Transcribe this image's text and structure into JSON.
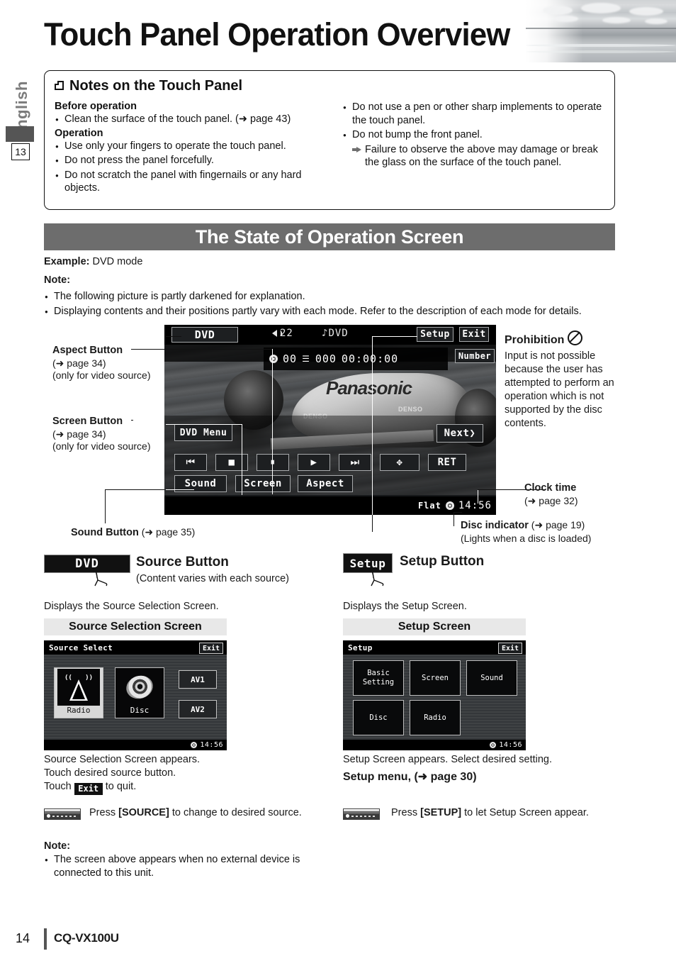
{
  "rail": {
    "language": "English",
    "chapter_number": "13"
  },
  "header": {
    "title": "Touch Panel Operation Overview"
  },
  "notes_box": {
    "heading": "Notes on the Touch Panel",
    "left": {
      "before_operation_head": "Before operation",
      "before_operation_items": [
        "Clean the surface of the touch panel. (➜ page 43)"
      ],
      "operation_head": "Operation",
      "operation_items": [
        "Use only your fingers to operate the touch panel.",
        "Do not press the panel forcefully.",
        "Do not scratch the panel with fingernails or any hard objects."
      ]
    },
    "right": {
      "items": [
        "Do not use a pen or other sharp implements to operate the touch panel.",
        "Do not bump the front panel."
      ],
      "sub_item": "Failure to observe the above may damage or break the glass on the surface of the touch panel."
    }
  },
  "section": {
    "bar_title": "The State of Operation Screen",
    "example_label": "Example:",
    "example_value": "DVD mode",
    "note_head": "Note:",
    "note_items": [
      "The following picture is partly darkened for explanation.",
      "Displaying contents and their positions partly vary with each mode. Refer to the description of each mode for details."
    ]
  },
  "dvd_screen": {
    "source_button": "DVD",
    "volume": "22",
    "source_indicator": "DVD",
    "setup_button": "Setup",
    "exit_button": "Exit",
    "chapter_value": "00",
    "track_value": "000",
    "time_value": "00:00:00",
    "number_button": "Number",
    "dvd_menu_button": "DVD Menu",
    "next_button": "Next❯",
    "controls": [
      "⏮",
      "■",
      "⏸",
      "▶",
      "⏭",
      "✥"
    ],
    "ret_button": "RET",
    "sound_button": "Sound",
    "screen_button": "Screen",
    "aspect_button": "Aspect",
    "eq_status": "Flat",
    "clock": "14:56"
  },
  "callouts": {
    "aspect": {
      "title": "Aspect Button",
      "ref": "(➜ page 34)",
      "note": "(only for video source)"
    },
    "screen": {
      "title": "Screen Button",
      "ref": "(➜ page 34)",
      "note": "(only for video source)"
    },
    "sound": {
      "title": "Sound Button",
      "ref": "(➜ page 35)"
    },
    "prohibition": {
      "title": "Prohibition",
      "body": "Input is not possible because the user has attempted to perform an operation which is not supported by the disc contents."
    },
    "clock_time": {
      "title": "Clock time",
      "ref": "(➜ page 32)"
    },
    "disc_indicator": {
      "title": "Disc indicator",
      "ref": "(➜ page 19)",
      "note": "(Lights when a disc is loaded)"
    }
  },
  "source_column": {
    "icon_label": "DVD",
    "title": "Source Button",
    "subtitle": "(Content varies with each source)",
    "description": "Displays the Source Selection Screen.",
    "screen_label": "Source Selection Screen",
    "device": {
      "top_title": "Source Select",
      "exit": "Exit",
      "tiles": [
        {
          "label": "Radio",
          "selected": true
        },
        {
          "label": "Disc",
          "selected": false
        }
      ],
      "side_buttons": [
        "AV1",
        "AV2"
      ],
      "clock": "14:56"
    },
    "after_lines": [
      "Source Selection Screen appears.",
      "Touch desired source button."
    ],
    "touch_prefix": "Touch",
    "touch_exit_label": "Exit",
    "touch_suffix": "to quit.",
    "press_text_pre": "Press",
    "press_key": "[SOURCE]",
    "press_text_post": "to change to desired source."
  },
  "setup_column": {
    "icon_label": "Setup",
    "title": "Setup Button",
    "description": "Displays the Setup Screen.",
    "screen_label": "Setup Screen",
    "device": {
      "top_title": "Setup",
      "exit": "Exit",
      "tiles": [
        "Basic\nSetting",
        "Screen",
        "Sound",
        "Disc",
        "Radio"
      ],
      "clock": "14:56"
    },
    "after_line": "Setup Screen appears. Select desired setting.",
    "menu_line": "Setup menu, (➜ page 30)",
    "press_text_pre": "Press",
    "press_key": "[SETUP]",
    "press_text_post": "to let Setup Screen appear."
  },
  "bottom_note": {
    "head": "Note:",
    "items": [
      "The screen above appears when no external device is connected to this unit."
    ]
  },
  "footer": {
    "page_number": "14",
    "model": "CQ-VX100U"
  },
  "colors": {
    "section_bar": "#6d6d6d",
    "rail_text": "#7b7b7b",
    "ink": "#111111"
  }
}
